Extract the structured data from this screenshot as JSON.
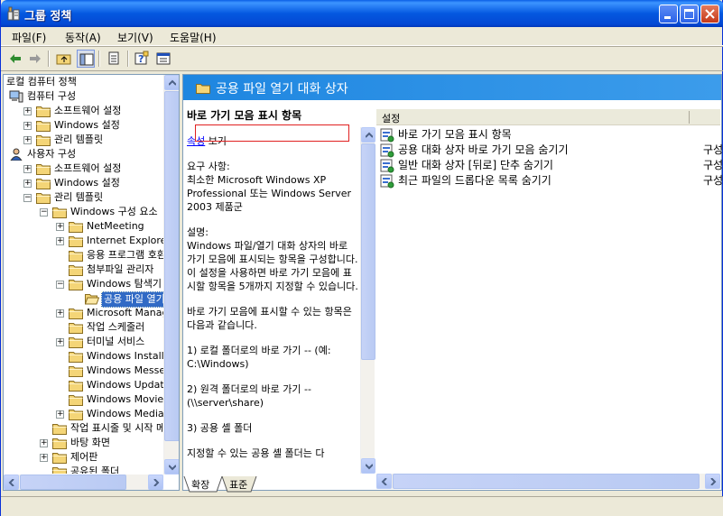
{
  "window": {
    "title": "그룹 정책"
  },
  "menu": [
    "파일(F)",
    "동작(A)",
    "보기(V)",
    "도움말(H)"
  ],
  "toolbar": {
    "icons": [
      "back-icon",
      "forward-icon",
      "up-folder-icon",
      "show-tree-icon",
      "export-list-icon",
      "help-icon",
      "properties-icon"
    ]
  },
  "tree": {
    "rows": [
      {
        "label": "로컬 컴퓨터 정책",
        "icon": "none"
      },
      {
        "label": "컴퓨터 구성",
        "icon": "computer"
      },
      {
        "label": "소프트웨어 설정",
        "icon": "folder",
        "exp": "+"
      },
      {
        "label": "Windows 설정",
        "icon": "folder",
        "exp": "+"
      },
      {
        "label": "관리 템플릿",
        "icon": "folder",
        "exp": "+"
      },
      {
        "label": "사용자 구성",
        "icon": "user"
      },
      {
        "label": "소프트웨어 설정",
        "icon": "folder",
        "exp": "+"
      },
      {
        "label": "Windows 설정",
        "icon": "folder",
        "exp": "+"
      },
      {
        "label": "관리 템플릿",
        "icon": "folder",
        "exp": "-"
      },
      {
        "label": "Windows 구성 요소",
        "icon": "folder",
        "exp": "-"
      },
      {
        "label": "NetMeeting",
        "icon": "folder",
        "exp": "+"
      },
      {
        "label": "Internet Explorer",
        "icon": "folder",
        "exp": "+"
      },
      {
        "label": "응용 프로그램 호환",
        "icon": "folder"
      },
      {
        "label": "첨부파일 관리자",
        "icon": "folder"
      },
      {
        "label": "Windows 탐색기",
        "icon": "folder",
        "exp": "-"
      },
      {
        "label": "공용 파일 열기",
        "icon": "folder-open",
        "selected": true
      },
      {
        "label": "Microsoft Manageme",
        "icon": "folder",
        "exp": "+"
      },
      {
        "label": "작업 스케줄러",
        "icon": "folder"
      },
      {
        "label": "터미널 서비스",
        "icon": "folder",
        "exp": "+"
      },
      {
        "label": "Windows Installer",
        "icon": "folder"
      },
      {
        "label": "Windows Messenger",
        "icon": "folder"
      },
      {
        "label": "Windows Update",
        "icon": "folder"
      },
      {
        "label": "Windows Movie Make",
        "icon": "folder"
      },
      {
        "label": "Windows Media Play",
        "icon": "folder",
        "exp": "+"
      },
      {
        "label": "작업 표시줄 및 시작 메",
        "icon": "folder"
      },
      {
        "label": "바탕 화면",
        "icon": "folder",
        "exp": "+"
      },
      {
        "label": "제어판",
        "icon": "folder",
        "exp": "+"
      },
      {
        "label": "공유된 폴더",
        "icon": "folder"
      }
    ]
  },
  "right": {
    "header_title": "공용 파일 열기 대화 상자",
    "desc": {
      "title": "바로 가기 모음 표시 항목",
      "link": "속성",
      "link_suffix": " 보기",
      "req_label": "요구 사항:",
      "req_text": "최소한 Microsoft Windows XP Professional 또는 Windows Server 2003 제품군",
      "desc_label": "설명:",
      "desc_text": "Windows 파일/열기 대화 상자의 바로 가기 모음에 표시되는 항목을 구성합니다. 이 설정을 사용하면 바로 가기 모음에 표시할 항목을 5개까지 지정할 수 있습니다.",
      "p2": "바로 가기 모음에 표시할 수 있는 항목은 다음과 같습니다.",
      "p3": "1) 로컬 폴더로의 바로 가기 -- (예: C:\\Windows)",
      "p4": "2) 원격 폴더로의 바로 가기 -- (\\\\server\\share)",
      "p5": "3) 공용 셸 폴더",
      "p6": "지정할 수 있는 공용 셸 폴더는 다"
    },
    "list": {
      "col_setting": "설정",
      "rows": [
        {
          "label": "바로 가기 모음 표시 항목",
          "state": ""
        },
        {
          "label": "공용 대화 상자 바로 가기 모음 숨기기",
          "state": "구성"
        },
        {
          "label": "일반 대화 상자 [뒤로] 단추 숨기기",
          "state": "구성"
        },
        {
          "label": "최근 파일의 드롭다운 목록 숨기기",
          "state": "구성"
        }
      ]
    }
  },
  "tabs": [
    "확장",
    "표준"
  ]
}
